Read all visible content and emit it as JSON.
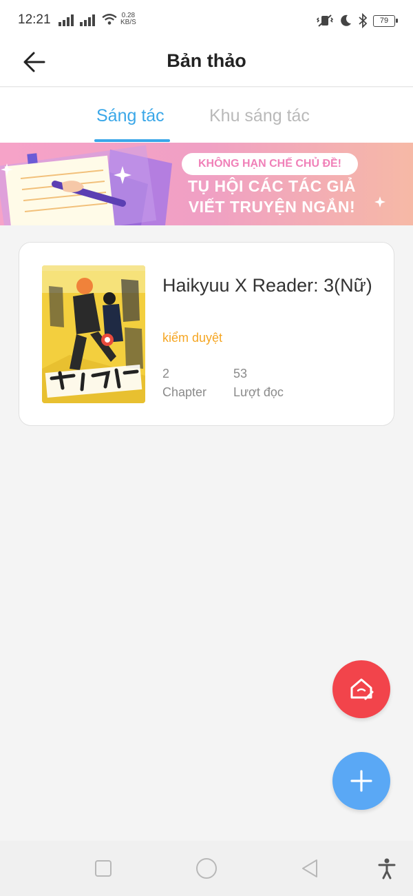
{
  "status_bar": {
    "time": "12:21",
    "net_speed_value": "0.28",
    "net_speed_unit": "KB/S",
    "battery": "79",
    "icons": [
      "signal-icon",
      "signal-icon",
      "wifi-icon",
      "vibrate-icon",
      "moon-icon",
      "bluetooth-icon",
      "battery-icon"
    ]
  },
  "header": {
    "title": "Bản thảo",
    "back_icon": "arrow-left-icon"
  },
  "tabs": [
    {
      "label": "Sáng tác",
      "active": true
    },
    {
      "label": "Khu sáng tác",
      "active": false
    }
  ],
  "banner": {
    "tag": "KHÔNG HẠN CHẾ CHỦ ĐỀ!",
    "line1": "TỤ HỘI CÁC TÁC GIẢ",
    "line2": "VIẾT TRUYỆN NGẮN!"
  },
  "story": {
    "title": "Haikyuu X Reader: 3(Nữ)",
    "status": "kiểm duyệt",
    "chapter_count": "2",
    "chapter_label": "Chapter",
    "read_count": "53",
    "read_label": "Lượt đọc"
  },
  "fabs": {
    "house_icon": "house-edit-icon",
    "add_icon": "plus-icon"
  },
  "nav": [
    "recent-apps-icon",
    "home-icon",
    "back-icon",
    "accessibility-icon"
  ],
  "colors": {
    "accent_blue": "#3aa7e8",
    "status_orange": "#f5a623",
    "fab_red": "#f2444b",
    "fab_blue": "#5aa8f5",
    "banner_pink": "#f6a3c8"
  }
}
